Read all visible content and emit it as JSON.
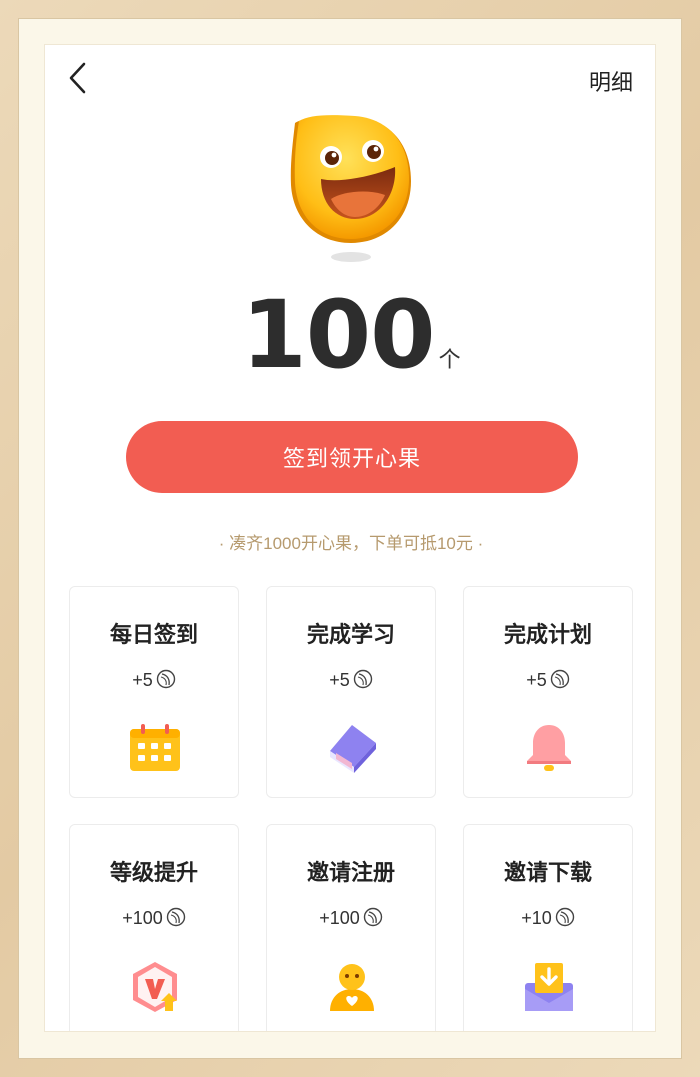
{
  "header": {
    "back_icon": "chevron-left-icon",
    "detail_label": "明细"
  },
  "balance": {
    "count": "100",
    "unit": "个"
  },
  "sign_button": {
    "label": "签到领开心果",
    "color": "#f25d52"
  },
  "tip": "· 凑齐1000开心果，下单可抵10元 ·",
  "tasks": [
    {
      "title": "每日签到",
      "points": "+5",
      "icon": "calendar-icon"
    },
    {
      "title": "完成学习",
      "points": "+5",
      "icon": "book-icon"
    },
    {
      "title": "完成计划",
      "points": "+5",
      "icon": "bell-icon"
    },
    {
      "title": "等级提升",
      "points": "+100",
      "icon": "vip-level-up-icon"
    },
    {
      "title": "邀请注册",
      "points": "+100",
      "icon": "user-heart-icon"
    },
    {
      "title": "邀请下载",
      "points": "+10",
      "icon": "download-icon"
    }
  ],
  "colors": {
    "accent": "#f25d52",
    "tip_text": "#b69a6e",
    "frame": "#e8d3b2"
  }
}
